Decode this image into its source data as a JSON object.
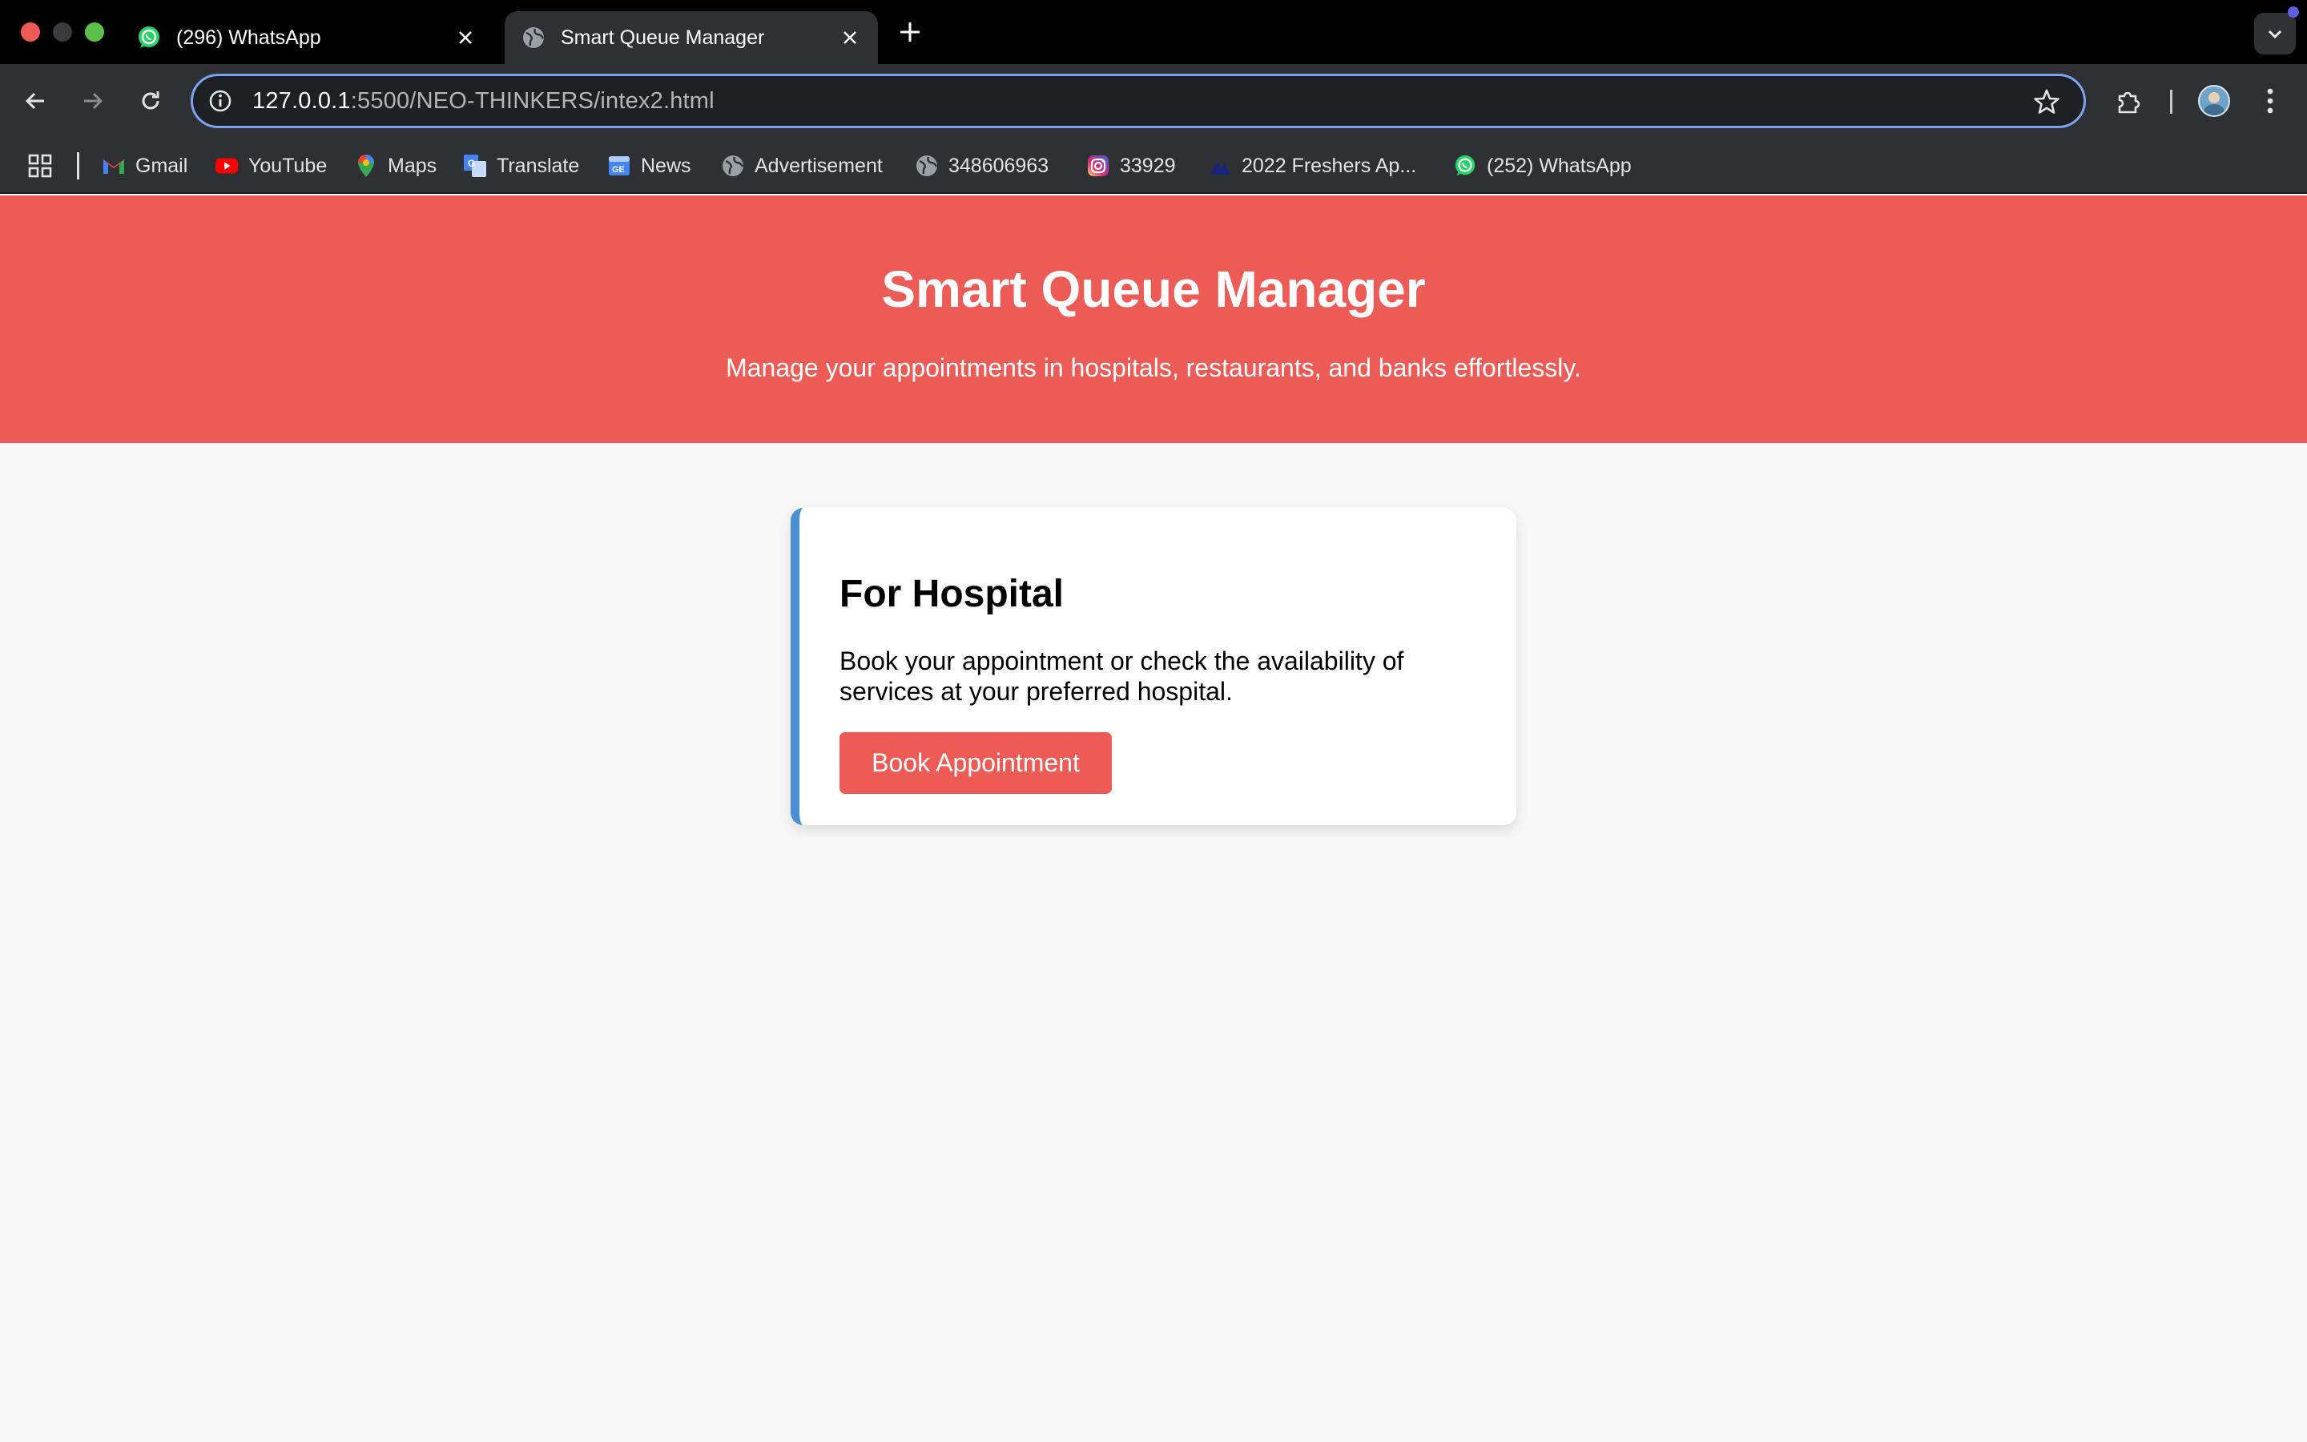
{
  "browser": {
    "tabs": [
      {
        "title": "(296) WhatsApp",
        "icon": "whatsapp-icon",
        "active": false
      },
      {
        "title": "Smart Queue Manager",
        "icon": "globe-icon",
        "active": true
      }
    ],
    "address_bar": {
      "host": "127.0.0.1",
      "path": ":5500/NEO-THINKERS/intex2.html"
    },
    "bookmarks": [
      {
        "label": "Gmail",
        "icon": "gmail-icon"
      },
      {
        "label": "YouTube",
        "icon": "youtube-icon"
      },
      {
        "label": "Maps",
        "icon": "maps-icon"
      },
      {
        "label": "Translate",
        "icon": "translate-icon"
      },
      {
        "label": "News",
        "icon": "news-icon"
      },
      {
        "label": "Advertisement",
        "icon": "globe-icon"
      },
      {
        "label": "348606963",
        "icon": "globe-icon"
      },
      {
        "label": "33929",
        "icon": "instagram-icon"
      },
      {
        "label": "2022 Freshers Ap...",
        "icon": "bookmark-site-icon"
      },
      {
        "label": "(252) WhatsApp",
        "icon": "whatsapp-icon"
      }
    ]
  },
  "header": {
    "title": "Smart Queue Manager",
    "subtitle": "Manage your appointments in hospitals, restaurants, and banks effortlessly."
  },
  "card": {
    "title": "For Hospital",
    "description": "Book your appointment or check the availability of services at your preferred hospital.",
    "button_label": "Book Appointment"
  },
  "colors": {
    "header_bg": "#ec5b55",
    "card_accent": "#4a8fd1",
    "button_bg": "#ec5b55",
    "page_bg": "#f8f8f8"
  }
}
